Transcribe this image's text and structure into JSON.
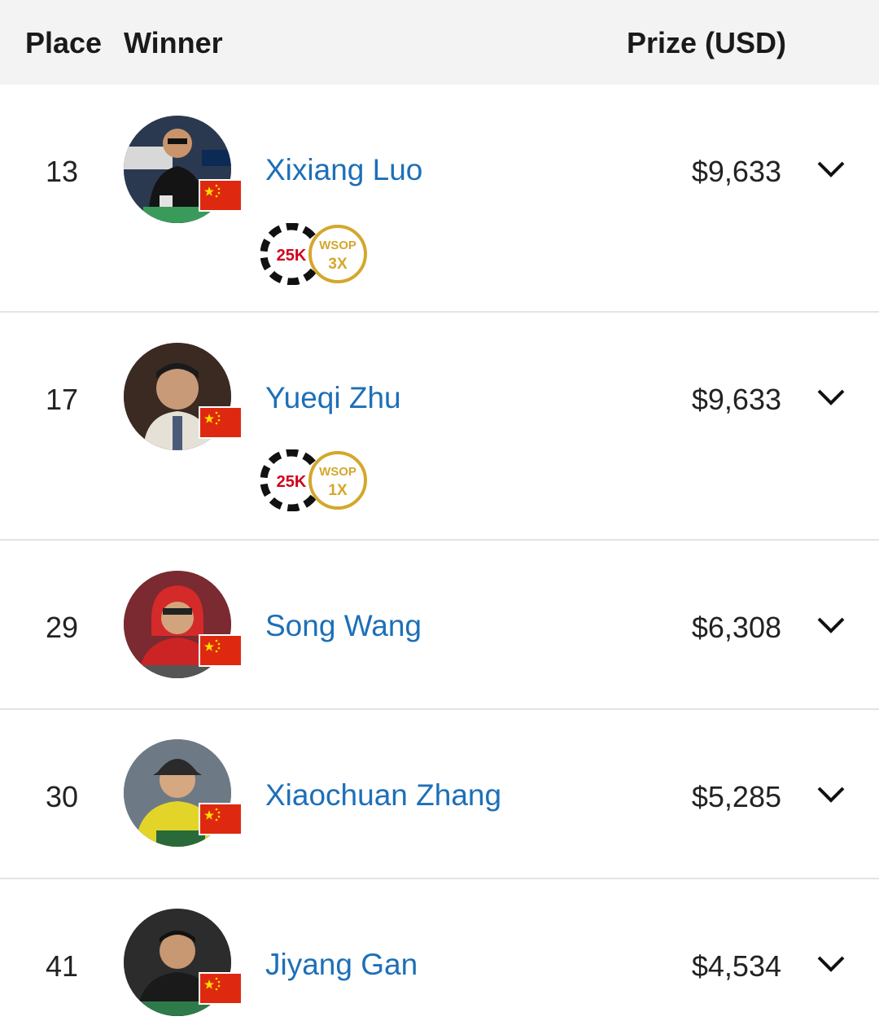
{
  "header": {
    "place": "Place",
    "winner": "Winner",
    "prize": "Prize (USD)"
  },
  "rows": [
    {
      "place": "13",
      "name": "Xixiang Luo",
      "prize": "$9,633",
      "chip": "25K",
      "wsop_brand": "WSOP",
      "wsop_count": "3X",
      "country_flag": "china-flag",
      "avatar_bg": "#2b3950"
    },
    {
      "place": "17",
      "name": "Yueqi Zhu",
      "prize": "$9,633",
      "chip": "25K",
      "wsop_brand": "WSOP",
      "wsop_count": "1X",
      "country_flag": "china-flag",
      "avatar_bg": "#3a2a22"
    },
    {
      "place": "29",
      "name": "Song Wang",
      "prize": "$6,308",
      "country_flag": "china-flag",
      "avatar_bg": "#7a2a30"
    },
    {
      "place": "30",
      "name": "Xiaochuan Zhang",
      "prize": "$5,285",
      "country_flag": "china-flag",
      "avatar_bg": "#6d7a86"
    },
    {
      "place": "41",
      "name": "Jiyang Gan",
      "prize": "$4,534",
      "country_flag": "china-flag",
      "avatar_bg": "#2c2c2c"
    }
  ],
  "colors": {
    "link": "#1d6fb8",
    "header_bg": "#f3f3f3",
    "divider": "#e4e4e4",
    "flag_red": "#de2910",
    "flag_star": "#ffde00",
    "chip_red": "#d0021b",
    "wsop_gold": "#d4a72c"
  }
}
